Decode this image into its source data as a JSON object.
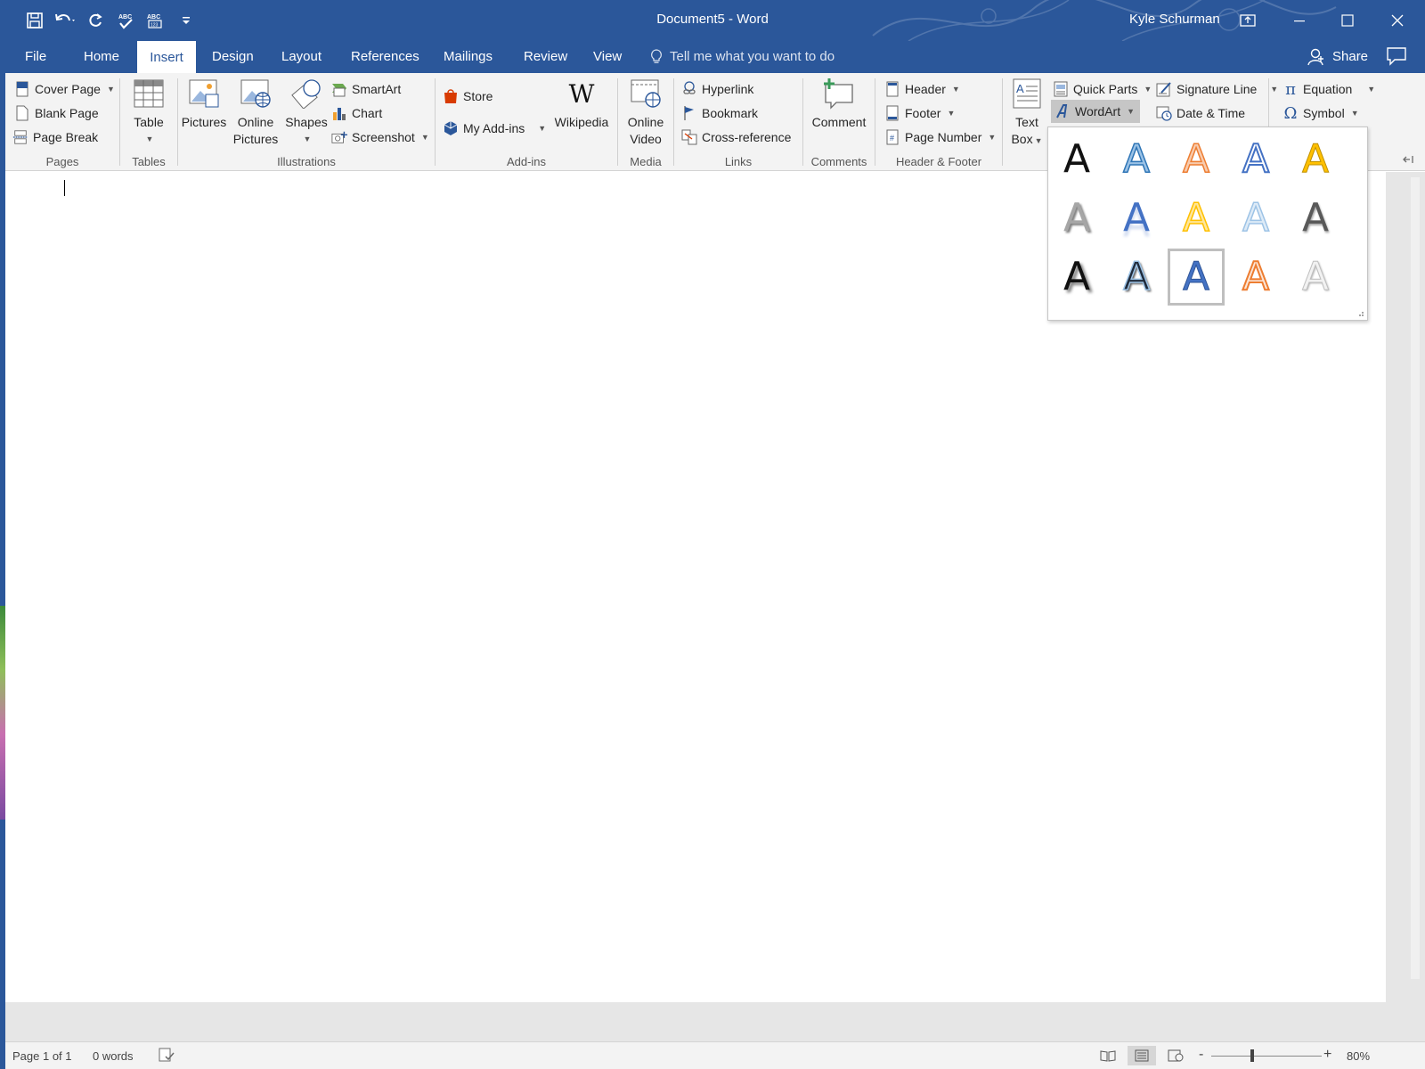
{
  "window": {
    "title": "Document5  -  Word",
    "user": "Kyle Schurman",
    "accent": "#2b579a"
  },
  "quick_access": [
    {
      "name": "save-icon"
    },
    {
      "name": "undo-icon"
    },
    {
      "name": "redo-icon"
    },
    {
      "name": "spelling-check-icon"
    },
    {
      "name": "abc-icon"
    },
    {
      "name": "customize-qat-icon"
    }
  ],
  "tabs": [
    "File",
    "Home",
    "Insert",
    "Design",
    "Layout",
    "References",
    "Mailings",
    "Review",
    "View"
  ],
  "active_tab": "Insert",
  "tell_me": "Tell me what you want to do",
  "share": "Share",
  "ribbon": {
    "pages": {
      "label": "Pages",
      "cover_page": "Cover Page",
      "blank_page": "Blank Page",
      "page_break": "Page Break"
    },
    "tables": {
      "label": "Tables",
      "table": "Table"
    },
    "illustrations": {
      "label": "Illustrations",
      "pictures": "Pictures",
      "online_pictures_1": "Online",
      "online_pictures_2": "Pictures",
      "shapes": "Shapes",
      "smartart": "SmartArt",
      "chart": "Chart",
      "screenshot": "Screenshot"
    },
    "addins": {
      "label": "Add-ins",
      "store": "Store",
      "my_addins": "My Add-ins",
      "wikipedia": "Wikipedia"
    },
    "media": {
      "label": "Media",
      "online_video_1": "Online",
      "online_video_2": "Video"
    },
    "links": {
      "label": "Links",
      "hyperlink": "Hyperlink",
      "bookmark": "Bookmark",
      "cross_reference": "Cross-reference"
    },
    "comments": {
      "label": "Comments",
      "comment": "Comment"
    },
    "header_footer": {
      "label": "Header & Footer",
      "header": "Header",
      "footer": "Footer",
      "page_number": "Page Number"
    },
    "text": {
      "text_box_1": "Text",
      "text_box_2": "Box",
      "quick_parts": "Quick Parts",
      "wordart": "WordArt",
      "signature_line": "Signature Line",
      "date_time": "Date & Time"
    },
    "symbols": {
      "equation": "Equation",
      "symbol": "Symbol",
      "equation_glyph": "π",
      "symbol_glyph": "Ω"
    }
  },
  "wordart_gallery": {
    "glyph": "A",
    "styles": [
      {
        "name": "wordart-style-fill-black"
      },
      {
        "name": "wordart-style-fill-blue-outline"
      },
      {
        "name": "wordart-style-fill-orange-outline"
      },
      {
        "name": "wordart-style-outline-blue"
      },
      {
        "name": "wordart-style-fill-gold"
      },
      {
        "name": "wordart-style-gray-shadow"
      },
      {
        "name": "wordart-style-blue-reflection"
      },
      {
        "name": "wordart-style-gold-outline"
      },
      {
        "name": "wordart-style-light-blue-outline"
      },
      {
        "name": "wordart-style-gray-gradient"
      },
      {
        "name": "wordart-style-black-heavy-shadow"
      },
      {
        "name": "wordart-style-black-blue-outline"
      },
      {
        "name": "wordart-style-blue-selected"
      },
      {
        "name": "wordart-style-orange-outline"
      },
      {
        "name": "wordart-style-silver"
      }
    ]
  },
  "status": {
    "page": "Page 1 of 1",
    "words": "0 words",
    "zoom": "80%",
    "zoom_minus": "-",
    "zoom_plus": "+"
  }
}
